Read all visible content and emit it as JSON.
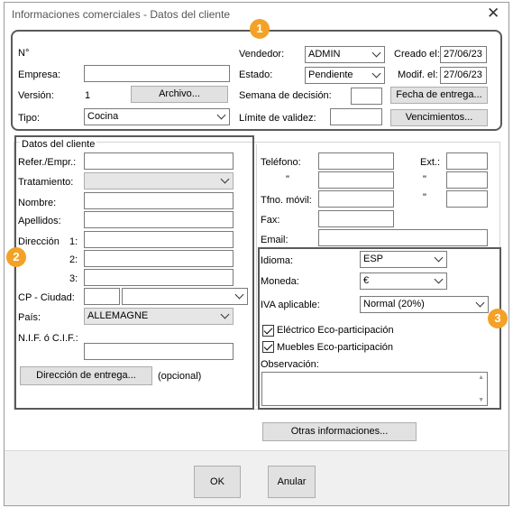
{
  "window": {
    "title": "Informaciones comerciales - Datos del cliente",
    "close_glyph": "✕"
  },
  "badges": [
    "1",
    "2",
    "3"
  ],
  "header": {
    "num_label": "N°",
    "empresa_label": "Empresa:",
    "empresa_value": "",
    "version_label": "Versión:",
    "version_value": "1",
    "archivo_button": "Archivo...",
    "tipo_label": "Tipo:",
    "tipo_value": "Cocina",
    "vendedor_label": "Vendedor:",
    "vendedor_value": "ADMIN",
    "estado_label": "Estado:",
    "estado_value": "Pendiente",
    "semana_label": "Semana de decisión:",
    "semana_value": "",
    "limite_label": "Límite de validez:",
    "limite_value": "",
    "creado_label": "Creado el:",
    "creado_value": "27/06/23",
    "modif_label": "Modif. el:",
    "modif_value": "27/06/23",
    "fecha_button": "Fecha de entrega...",
    "venc_button": "Vencimientos..."
  },
  "client": {
    "group_title": "Datos del cliente",
    "refer_label": "Refer./Empr.:",
    "tratamiento_label": "Tratamiento:",
    "nombre_label": "Nombre:",
    "apellidos_label": "Apellidos:",
    "direccion_label": "Dirección",
    "dir1": "1:",
    "dir2": "2:",
    "dir3": "3:",
    "cp_label": "CP - Ciudad:",
    "pais_label": "País:",
    "pais_value": "ALLEMAGNE",
    "nif_label": "N.I.F. ó  C.I.F.:",
    "direccion_entrega_button": "Dirección de entrega...",
    "opcional": "(opcional)",
    "telefono_label": "Teléfono:",
    "ext_label": "Ext.:",
    "tfno_movil_label": "Tfno. móvil:",
    "fax_label": "Fax:",
    "email_label": "Email:",
    "dash_glyph": "\""
  },
  "commercial": {
    "idioma_label": "Idioma:",
    "idioma_value": "ESP",
    "moneda_label": "Moneda:",
    "moneda_value": "€",
    "iva_label": "IVA aplicable:",
    "iva_value": "Normal (20%)",
    "electrico_label": "Eléctrico Eco-participación",
    "electrico_checked": true,
    "muebles_label": "Muebles Eco-participación",
    "muebles_checked": true,
    "observacion_label": "Observación:",
    "otras_button": "Otras informaciones..."
  },
  "footer": {
    "ok_button": "OK",
    "cancel_button": "Anular"
  },
  "colors": {
    "badge": "#f3a227",
    "frame": "#5a5a5a",
    "button": "#e1e1e1",
    "field_disabled": "#e6e6e6"
  }
}
